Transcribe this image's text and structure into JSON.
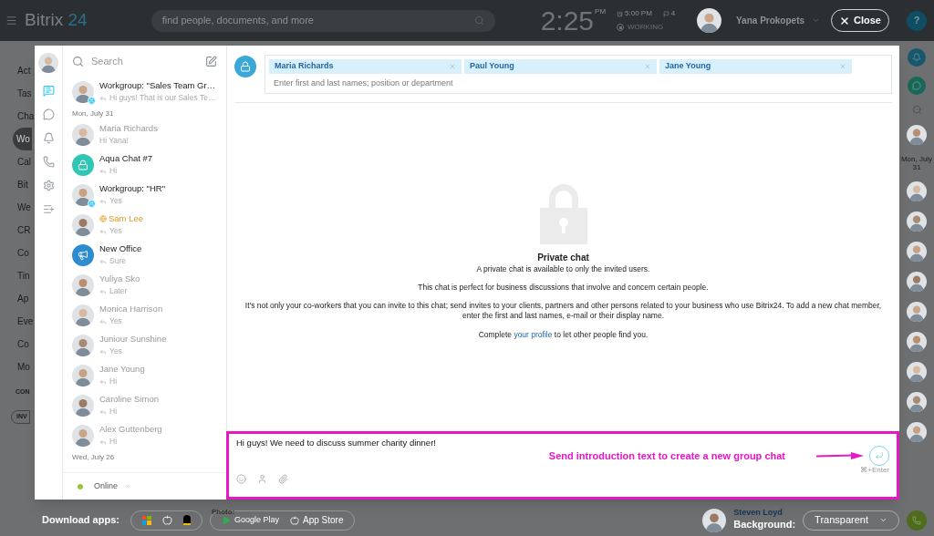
{
  "topbar": {
    "logo_text": "Bitrix",
    "logo_number": "24",
    "search_placeholder": "find people, documents, and more",
    "time": "2:25",
    "time_suffix": "PM",
    "alarm": "5:00 PM",
    "flag_count": "4",
    "status": "WORKING",
    "user_name": "Yana Prokopets",
    "close_label": "Close",
    "help_label": "?"
  },
  "background_menu": [
    {
      "label": "Act",
      "selected": false
    },
    {
      "label": "Tas",
      "selected": false
    },
    {
      "label": "Cha",
      "selected": false
    },
    {
      "label": "Wo",
      "selected": true
    },
    {
      "label": "Cal",
      "selected": false
    },
    {
      "label": "Bit",
      "selected": false
    },
    {
      "label": "We",
      "selected": false
    },
    {
      "label": "CR",
      "selected": false
    },
    {
      "label": "Co",
      "selected": false
    },
    {
      "label": "Tin",
      "selected": false
    },
    {
      "label": "Ap",
      "selected": false
    },
    {
      "label": "Eve",
      "selected": false
    },
    {
      "label": "Co",
      "selected": false
    },
    {
      "label": "Mo",
      "selected": false
    }
  ],
  "background_sections": [
    "CON",
    "INV"
  ],
  "background_right": {
    "date": "Mon, July 31"
  },
  "messenger": {
    "nav": [
      {
        "kind": "chat",
        "selected": true
      },
      {
        "kind": "history",
        "selected": false
      },
      {
        "kind": "bell",
        "selected": false
      },
      {
        "kind": "phone",
        "selected": false
      },
      {
        "kind": "gear",
        "selected": false
      },
      {
        "kind": "add",
        "selected": false
      }
    ],
    "search_placeholder": "Search",
    "chats": [
      {
        "kind": "chat",
        "avatar": {
          "kind": "photo"
        },
        "name": "Workgroup: \"Sales Team Gr…",
        "preview": "Hi guys! That is our Sales Te…",
        "unread": true,
        "replied": true,
        "group": true,
        "extranet": false
      },
      {
        "kind": "date",
        "label": "Mon, July 31"
      },
      {
        "kind": "chat",
        "avatar": {
          "kind": "photo"
        },
        "name": "Maria Richards",
        "preview": "Hi Yana!",
        "unread": false,
        "replied": false,
        "group": false,
        "extranet": false
      },
      {
        "kind": "chat",
        "avatar": {
          "kind": "lock"
        },
        "name": "Aqua Chat #7",
        "preview": "Hi",
        "unread": true,
        "replied": true,
        "group": false,
        "extranet": false
      },
      {
        "kind": "chat",
        "avatar": {
          "kind": "photo"
        },
        "name": "Workgroup: \"HR\"",
        "preview": "Yes",
        "unread": true,
        "replied": true,
        "group": true,
        "extranet": false
      },
      {
        "kind": "chat",
        "avatar": {
          "kind": "photo"
        },
        "name": "Sam Lee",
        "preview": "Yes",
        "unread": true,
        "replied": true,
        "group": false,
        "extranet": true
      },
      {
        "kind": "chat",
        "avatar": {
          "kind": "megaphone"
        },
        "name": "New Office",
        "preview": "Sure",
        "unread": true,
        "replied": true,
        "group": false,
        "extranet": false
      },
      {
        "kind": "chat",
        "avatar": {
          "kind": "photo"
        },
        "name": "Yuliya Sko",
        "preview": "Later",
        "unread": false,
        "replied": true,
        "group": false,
        "extranet": false
      },
      {
        "kind": "chat",
        "avatar": {
          "kind": "photo"
        },
        "name": "Monica Harrison",
        "preview": "Yes",
        "unread": false,
        "replied": true,
        "group": false,
        "extranet": false
      },
      {
        "kind": "chat",
        "avatar": {
          "kind": "photo"
        },
        "name": "Juniour Sunshine",
        "preview": "Yes",
        "unread": false,
        "replied": true,
        "group": false,
        "extranet": false
      },
      {
        "kind": "chat",
        "avatar": {
          "kind": "photo"
        },
        "name": "Jane Young",
        "preview": "Hi",
        "unread": false,
        "replied": true,
        "group": false,
        "extranet": false
      },
      {
        "kind": "chat",
        "avatar": {
          "kind": "photo"
        },
        "name": "Caroline Simon",
        "preview": "Hi",
        "unread": false,
        "replied": true,
        "group": false,
        "extranet": false
      },
      {
        "kind": "chat",
        "avatar": {
          "kind": "photo"
        },
        "name": "Alex Guttenberg",
        "preview": "Hi",
        "unread": false,
        "replied": true,
        "group": false,
        "extranet": false
      },
      {
        "kind": "date",
        "label": "Wed, July 26"
      }
    ],
    "status": "Online",
    "recipients": [
      {
        "name": "Maria Richards"
      },
      {
        "name": "Paul Young"
      },
      {
        "name": "Jane Young"
      }
    ],
    "recipient_placeholder": "Enter first and last names; position or department",
    "intro": {
      "title": "Private chat",
      "paragraphs": [
        "A private chat is available to only the invited users.",
        "This chat is perfect for business discussions that involve and concern certain people.",
        "It's not only your co-workers that you can invite to this chat; send invites to your clients, partners and other persons related to your business who use Bitrix24. To add a new chat member, enter the first and last names, e-mail or their display name."
      ],
      "profile_before": "Complete ",
      "profile_link": "your profile",
      "profile_after": " to let other people find you."
    },
    "composer": {
      "value": "Hi guys! We need to discuss summer charity dinner!",
      "hint": "⌘+Enter"
    },
    "annotation": "Send introduction text to create a new group chat"
  },
  "bottom_bar": {
    "download_label": "Download apps:",
    "stores": [
      "Google Play",
      "App Store"
    ],
    "photo_label": "Photo:",
    "person_name": "Steven Loyd",
    "background_label": "Background:",
    "background_value": "Transparent"
  }
}
